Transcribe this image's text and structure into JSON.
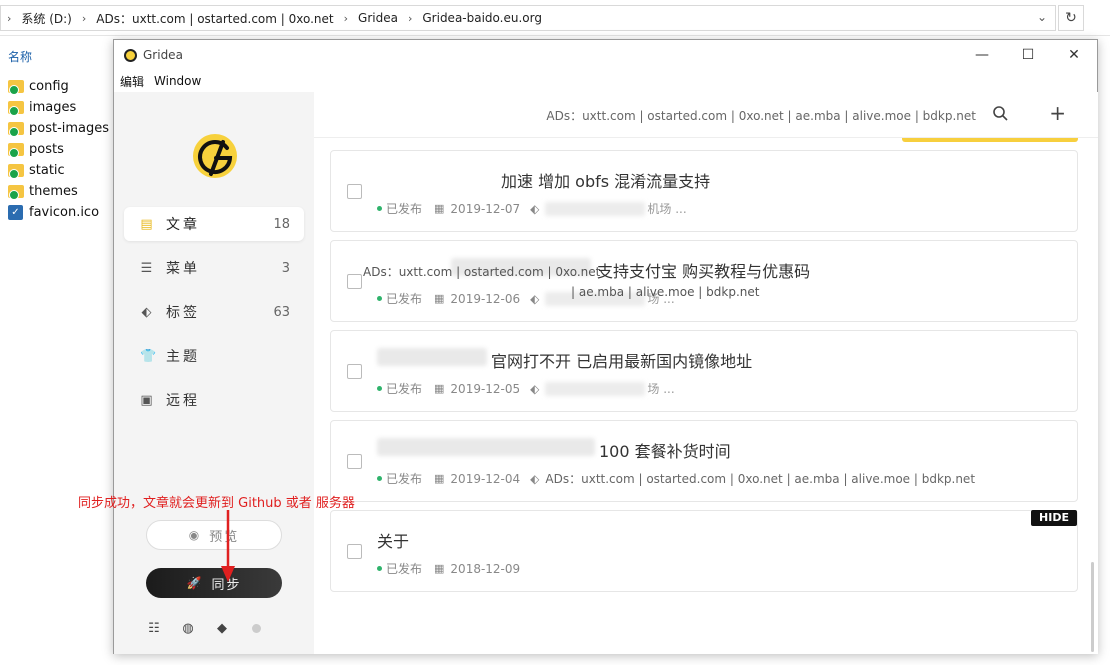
{
  "explorer": {
    "breadcrumbs": [
      "系统 (D:)",
      "ADs：uxtt.com | ostarted.com | 0xo.net",
      "Gridea",
      "Gridea-baido.eu.org"
    ],
    "column_header": "名称",
    "files": [
      {
        "name": "config",
        "type": "folder"
      },
      {
        "name": "images",
        "type": "folder"
      },
      {
        "name": "post-images",
        "type": "folder"
      },
      {
        "name": "posts",
        "type": "folder"
      },
      {
        "name": "static",
        "type": "folder"
      },
      {
        "name": "themes",
        "type": "folder"
      },
      {
        "name": "favicon.ico",
        "type": "icon-file"
      }
    ]
  },
  "window": {
    "title": "Gridea",
    "menu": [
      "编辑",
      "Window"
    ]
  },
  "sidebar": {
    "nav": [
      {
        "label": "文章",
        "count": "18",
        "icon": "file-icon"
      },
      {
        "label": "菜单",
        "count": "3",
        "icon": "menu-icon"
      },
      {
        "label": "标签",
        "count": "63",
        "icon": "tag-icon"
      },
      {
        "label": "主题",
        "count": "",
        "icon": "shirt-icon"
      },
      {
        "label": "远程",
        "count": "",
        "icon": "server-icon"
      }
    ],
    "preview_label": "预览",
    "sync_label": "同步"
  },
  "header": {
    "ads_text": "ADs：uxtt.com | ostarted.com | 0xo.net | ae.mba | alive.moe | bdkp.net"
  },
  "articles": [
    {
      "title": "加速 增加 obfs 混淆流量支持",
      "status": "已发布",
      "date": "2019-12-07",
      "tag_tail": "机场 ..."
    },
    {
      "title": "支持支付宝 购买教程与优惠码",
      "status": "已发布",
      "date": "2019-12-06",
      "tag_tail": "场 ...",
      "ads_line1": "ADs：uxtt.com | ostarted.com | 0xo.net",
      "ads_line2": "| ae.mba | alive.moe | bdkp.net"
    },
    {
      "title": "官网打不开 已启用最新国内镜像地址",
      "status": "已发布",
      "date": "2019-12-05",
      "tag_tail": "场 ..."
    },
    {
      "title": "100 套餐补货时间",
      "status": "已发布",
      "date": "2019-12-04",
      "ads_inline": "ADs：uxtt.com | ostarted.com | 0xo.net | ae.mba | alive.moe | bdkp.net"
    },
    {
      "title": "关于",
      "status": "已发布",
      "date": "2018-12-09",
      "badge": "HIDE"
    }
  ],
  "annotation": "同步成功，文章就会更新到 Github 或者 服务器",
  "colors": {
    "accent": "#f7cf3e",
    "published": "#2fb36b",
    "annotation": "#e02020"
  }
}
